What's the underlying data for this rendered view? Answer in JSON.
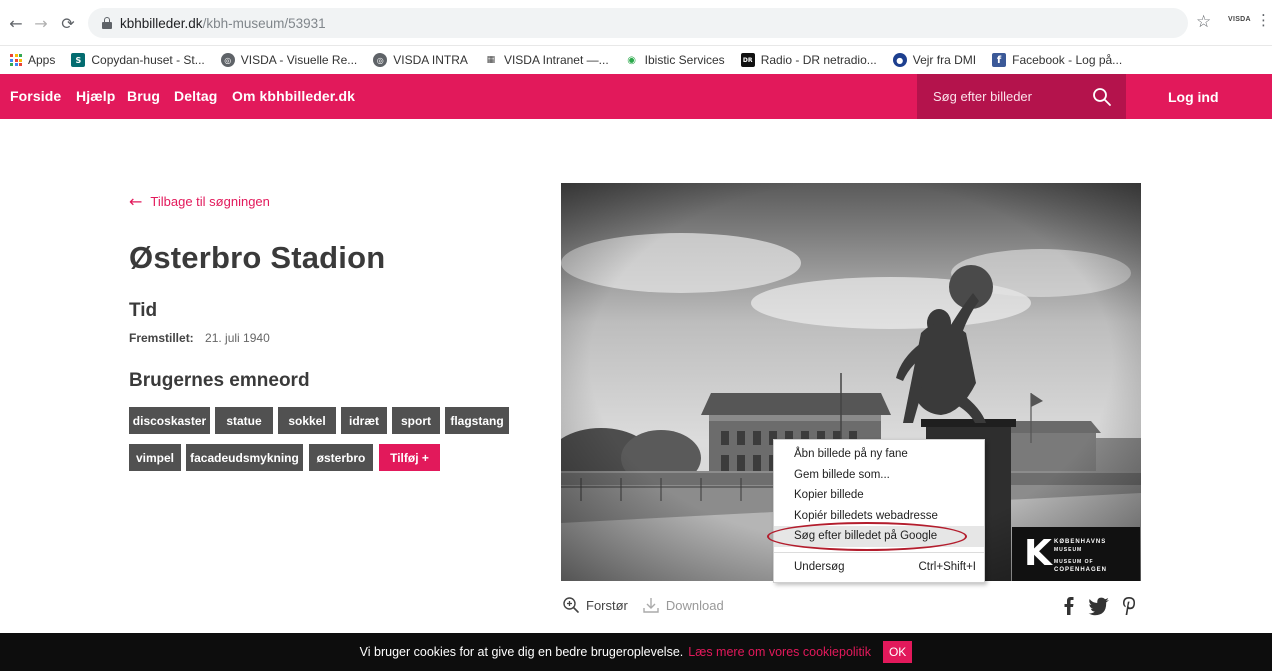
{
  "browser": {
    "url_domain": "kbhbilleder.dk",
    "url_path": "/kbh-museum/53931",
    "extension_label": "VISDA",
    "bookmarks": [
      {
        "label": "Apps",
        "icon": "apps-grid-icon"
      },
      {
        "label": "Copydan-huset - St...",
        "icon": "sharepoint-icon",
        "color": "#036c70"
      },
      {
        "label": "VISDA - Visuelle Re...",
        "icon": "globe-icon",
        "color": "#5f6368"
      },
      {
        "label": "VISDA INTRA",
        "icon": "globe-icon",
        "color": "#5f6368"
      },
      {
        "label": "VISDA Intranet —...",
        "icon": "intranet-icon",
        "color": "#444444"
      },
      {
        "label": "Ibistic Services",
        "icon": "eye-icon",
        "color": "#2aa84a"
      },
      {
        "label": "Radio - DR netradio...",
        "icon": "dr-icon",
        "color": "#111111"
      },
      {
        "label": "Vejr fra DMI",
        "icon": "dmi-icon",
        "color": "#1d3f8f"
      },
      {
        "label": "Facebook - Log på...",
        "icon": "facebook-icon",
        "color": "#3b5998"
      }
    ]
  },
  "site": {
    "brand_color": "#e2195b",
    "nav": [
      "Forside",
      "Hjælp",
      "Brug",
      "Deltag",
      "Om kbhbilleder.dk"
    ],
    "search_placeholder": "Søg efter billeder",
    "login_label": "Log ind"
  },
  "record": {
    "back_label": "Tilbage til søgningen",
    "title": "Østerbro Stadion",
    "time_heading": "Tid",
    "created_label": "Fremstillet:",
    "created_value": "21. juli 1940",
    "tags_heading": "Brugernes emneord",
    "tags": [
      "discoskaster",
      "statue",
      "sokkel",
      "idræt",
      "sport",
      "flagstang",
      "vimpel",
      "facadeudsmykning",
      "østerbro"
    ],
    "add_tag_label": "Tilføj +"
  },
  "photo": {
    "logo_k": "K",
    "logo_line1": "KØBENHAVNS",
    "logo_line2": "MUSEUM",
    "logo_line3": "MUSEUM OF",
    "logo_line4": "COPENHAGEN"
  },
  "context_menu": {
    "items": [
      "Åbn billede på ny fane",
      "Gem billede som...",
      "Kopier billede",
      "Kopiér billedets webadresse",
      "Søg efter billedet på Google"
    ],
    "inspect_label": "Undersøg",
    "inspect_shortcut": "Ctrl+Shift+I"
  },
  "photo_tools": {
    "zoom_label": "Forstør",
    "download_label": "Download"
  },
  "cookie": {
    "text": "Vi bruger cookies for at give dig en bedre brugeroplevelse.",
    "link": "Læs mere om vores cookiepolitik",
    "ok": "OK"
  }
}
